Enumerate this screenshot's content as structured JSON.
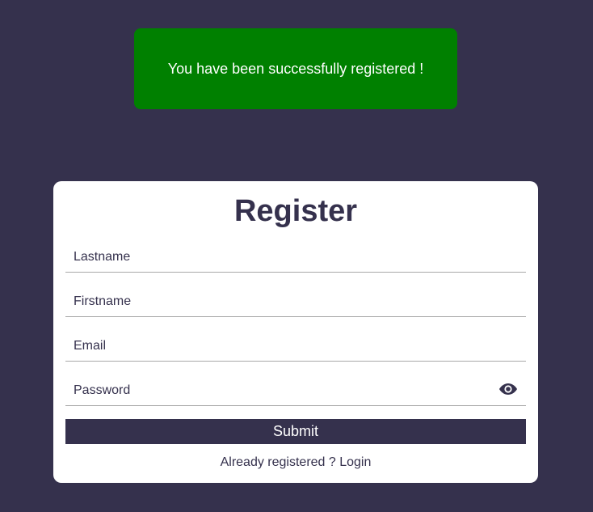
{
  "toast": {
    "message": "You have been successfully registered !",
    "color": "#008000"
  },
  "form": {
    "title": "Register",
    "fields": {
      "lastname": {
        "placeholder": "Lastname",
        "value": ""
      },
      "firstname": {
        "placeholder": "Firstname",
        "value": ""
      },
      "email": {
        "placeholder": "Email",
        "value": ""
      },
      "password": {
        "placeholder": "Password",
        "value": "",
        "toggle_icon": "eye-icon"
      }
    },
    "submit_label": "Submit",
    "footer": {
      "prefix": "Already registered ?",
      "link": "Login"
    }
  },
  "colors": {
    "background": "#35314d",
    "card": "#ffffff",
    "accent": "#35314d",
    "success": "#008000"
  }
}
